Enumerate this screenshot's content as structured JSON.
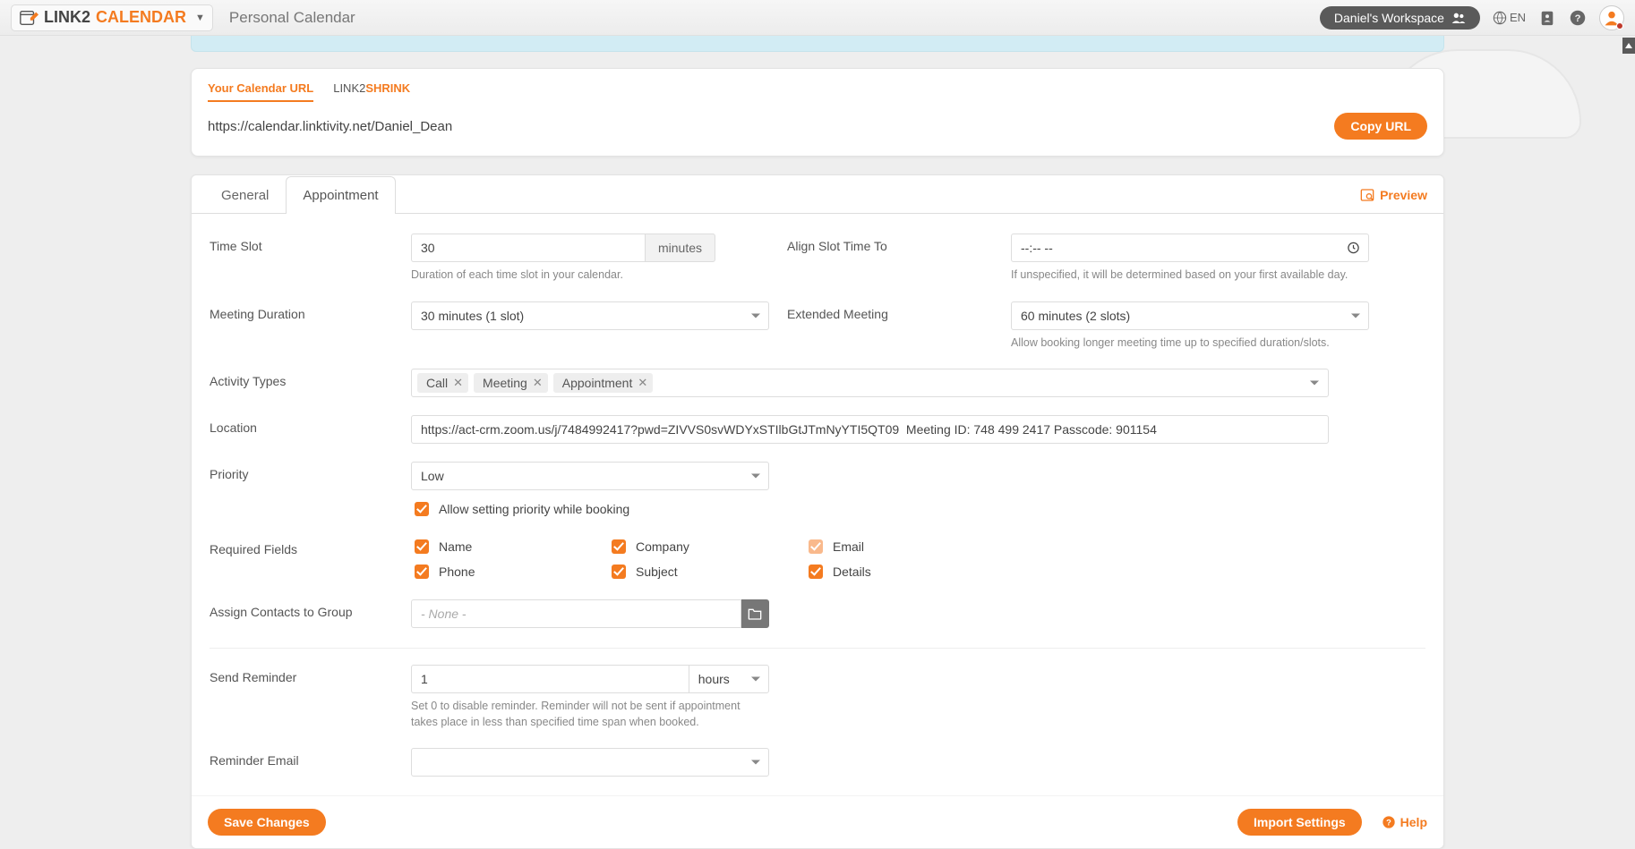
{
  "header": {
    "app_name_part1": "LINK2",
    "app_name_part2": "CALENDAR",
    "breadcrumb": "Personal Calendar",
    "workspace_label": "Daniel's Workspace",
    "language": "EN"
  },
  "url_card": {
    "tab_your_url": "Your Calendar URL",
    "tab_shrink_part1": "LINK2",
    "tab_shrink_part2": "SHRINK",
    "url_value": "https://calendar.linktivity.net/Daniel_Dean",
    "copy_btn": "Copy URL"
  },
  "tabs": {
    "general": "General",
    "appointment": "Appointment",
    "preview": "Preview"
  },
  "form": {
    "time_slot": {
      "label": "Time Slot",
      "value": "30",
      "unit": "minutes",
      "help": "Duration of each time slot in your calendar."
    },
    "align_slot": {
      "label": "Align Slot Time To",
      "value": "--:-- --",
      "help": "If unspecified, it will be determined based on your first available day."
    },
    "meeting_duration": {
      "label": "Meeting Duration",
      "value": "30 minutes (1 slot)"
    },
    "extended_meeting": {
      "label": "Extended Meeting",
      "value": "60 minutes (2 slots)",
      "help": "Allow booking longer meeting time up to specified duration/slots."
    },
    "activity_types": {
      "label": "Activity Types",
      "tags": [
        "Call",
        "Meeting",
        "Appointment"
      ]
    },
    "location": {
      "label": "Location",
      "value": "https://act-crm.zoom.us/j/7484992417?pwd=ZIVVS0svWDYxSTIlbGtJTmNyYTI5QT09  Meeting ID: 748 499 2417 Passcode: 901154"
    },
    "priority": {
      "label": "Priority",
      "value": "Low",
      "checkbox_label": "Allow setting priority while booking"
    },
    "required_fields": {
      "label": "Required Fields",
      "fields": {
        "name": "Name",
        "company": "Company",
        "email": "Email",
        "phone": "Phone",
        "subject": "Subject",
        "details": "Details"
      }
    },
    "assign_group": {
      "label": "Assign Contacts to Group",
      "placeholder": "- None -"
    },
    "send_reminder": {
      "label": "Send Reminder",
      "value": "1",
      "unit": "hours",
      "help": "Set 0 to disable reminder. Reminder will not be sent if appointment takes place in less than specified time span when booked."
    },
    "reminder_email": {
      "label": "Reminder Email"
    }
  },
  "footer": {
    "save": "Save Changes",
    "import": "Import Settings",
    "help": "Help"
  }
}
